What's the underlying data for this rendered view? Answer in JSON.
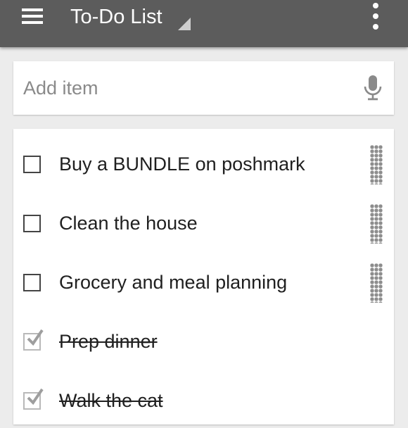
{
  "appbar": {
    "title": "To-Do List",
    "menu_icon": "hamburger-icon",
    "dropdown_icon": "dropdown-triangle-icon",
    "overflow_icon": "more-vert-icon"
  },
  "add_item": {
    "placeholder": "Add item",
    "value": "",
    "mic_icon": "microphone-icon"
  },
  "items": [
    {
      "label": "Buy a BUNDLE on poshmark",
      "checked": false
    },
    {
      "label": "Clean the house",
      "checked": false
    },
    {
      "label": "Grocery and meal planning",
      "checked": false
    },
    {
      "label": "Prep dinner",
      "checked": true
    },
    {
      "label": "Walk the cat",
      "checked": true
    }
  ],
  "colors": {
    "appbar": "#5c5c5c",
    "background": "#ececec",
    "card": "#ffffff",
    "text": "#202020",
    "placeholder": "#8a8a8a",
    "checked_mark": "#b9b9b9",
    "drag_handle": "#8d8d8d"
  }
}
